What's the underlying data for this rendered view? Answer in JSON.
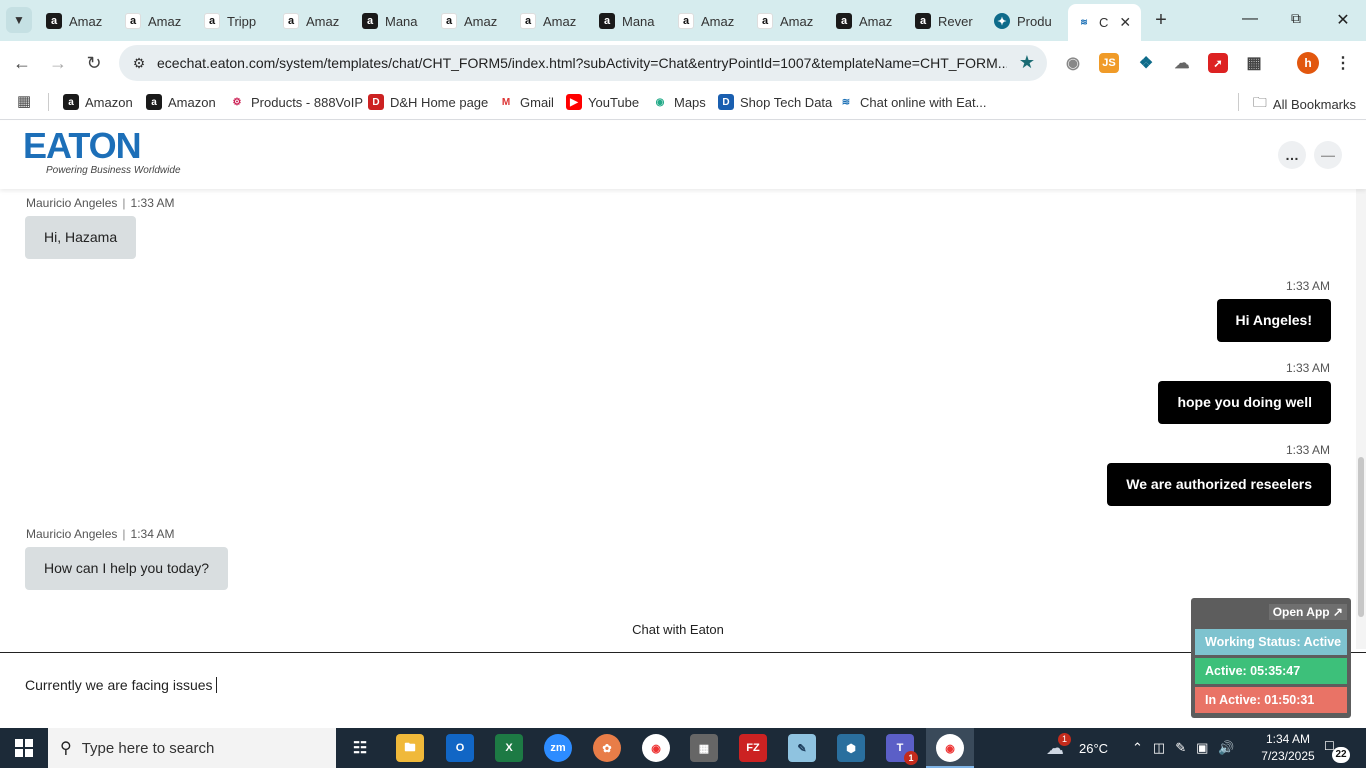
{
  "browser": {
    "tabs": [
      {
        "title": "Amaz",
        "favicon": "amazon-dark"
      },
      {
        "title": "Amaz",
        "favicon": "amazon-light"
      },
      {
        "title": "Tripp",
        "favicon": "amazon-light"
      },
      {
        "title": "Amaz",
        "favicon": "amazon-light"
      },
      {
        "title": "Mana",
        "favicon": "amazon-dark"
      },
      {
        "title": "Amaz",
        "favicon": "amazon-light"
      },
      {
        "title": "Amaz",
        "favicon": "amazon-light"
      },
      {
        "title": "Mana",
        "favicon": "amazon-dark"
      },
      {
        "title": "Amaz",
        "favicon": "amazon-light"
      },
      {
        "title": "Amaz",
        "favicon": "amazon-light"
      },
      {
        "title": "Amaz",
        "favicon": "amazon-dark"
      },
      {
        "title": "Rever",
        "favicon": "amazon-dark"
      },
      {
        "title": "Produ",
        "favicon": "product-globe"
      }
    ],
    "active_tab": {
      "title": "C",
      "favicon": "eaton-chat"
    },
    "url": "ecechat.eaton.com/system/templates/chat/CHT_FORM5/index.html?subActivity=Chat&entryPointId=1007&templateName=CHT_FORM...",
    "profile_initial": "h",
    "bookmarks": [
      {
        "label": "Amazon",
        "icon": "amazon-dark"
      },
      {
        "label": "Amazon",
        "icon": "amazon-dark"
      },
      {
        "label": "Products - 888VoIP",
        "icon": "voip-icon"
      },
      {
        "label": "D&H Home page",
        "icon": "dh-icon"
      },
      {
        "label": "Gmail",
        "icon": "gmail-icon"
      },
      {
        "label": "YouTube",
        "icon": "youtube-icon"
      },
      {
        "label": "Maps",
        "icon": "maps-icon"
      },
      {
        "label": "Shop Tech Data",
        "icon": "techdata-icon"
      },
      {
        "label": "Chat online with Eat...",
        "icon": "eaton-chat"
      }
    ],
    "all_bookmarks": "All Bookmarks"
  },
  "site": {
    "logo_text": "EATON",
    "tagline": "Powering Business Worldwide"
  },
  "chat": {
    "messages": [
      {
        "from": "agent",
        "sender": "Mauricio Angeles",
        "time": "1:33 AM",
        "text": "Hi, Hazama"
      },
      {
        "from": "user",
        "time": "1:33 AM",
        "text": "Hi Angeles!"
      },
      {
        "from": "user",
        "time": "1:33 AM",
        "text": "hope you doing well"
      },
      {
        "from": "user",
        "time": "1:33 AM",
        "text": "We are authorized reseelers"
      },
      {
        "from": "agent",
        "sender": "Mauricio Angeles",
        "time": "1:34 AM",
        "text": "How can I help you today?"
      }
    ],
    "footer_label": "Chat with Eaton",
    "composer_value": "Currently we are facing issues"
  },
  "status_widget": {
    "open_app": "Open App ↗",
    "working_status": "Working Status: Active",
    "active": "Active: 05:35:47",
    "inactive": "In Active: 01:50:31",
    "colors": {
      "working": "#7ec3cf",
      "active": "#3dc07a",
      "inactive": "#e97366"
    }
  },
  "taskbar": {
    "search_placeholder": "Type here to search",
    "weather_temp": "26°C",
    "weather_badge": "1",
    "time": "1:34 AM",
    "date": "7/23/2025",
    "notification_count": "22",
    "teams_badge": "1"
  }
}
